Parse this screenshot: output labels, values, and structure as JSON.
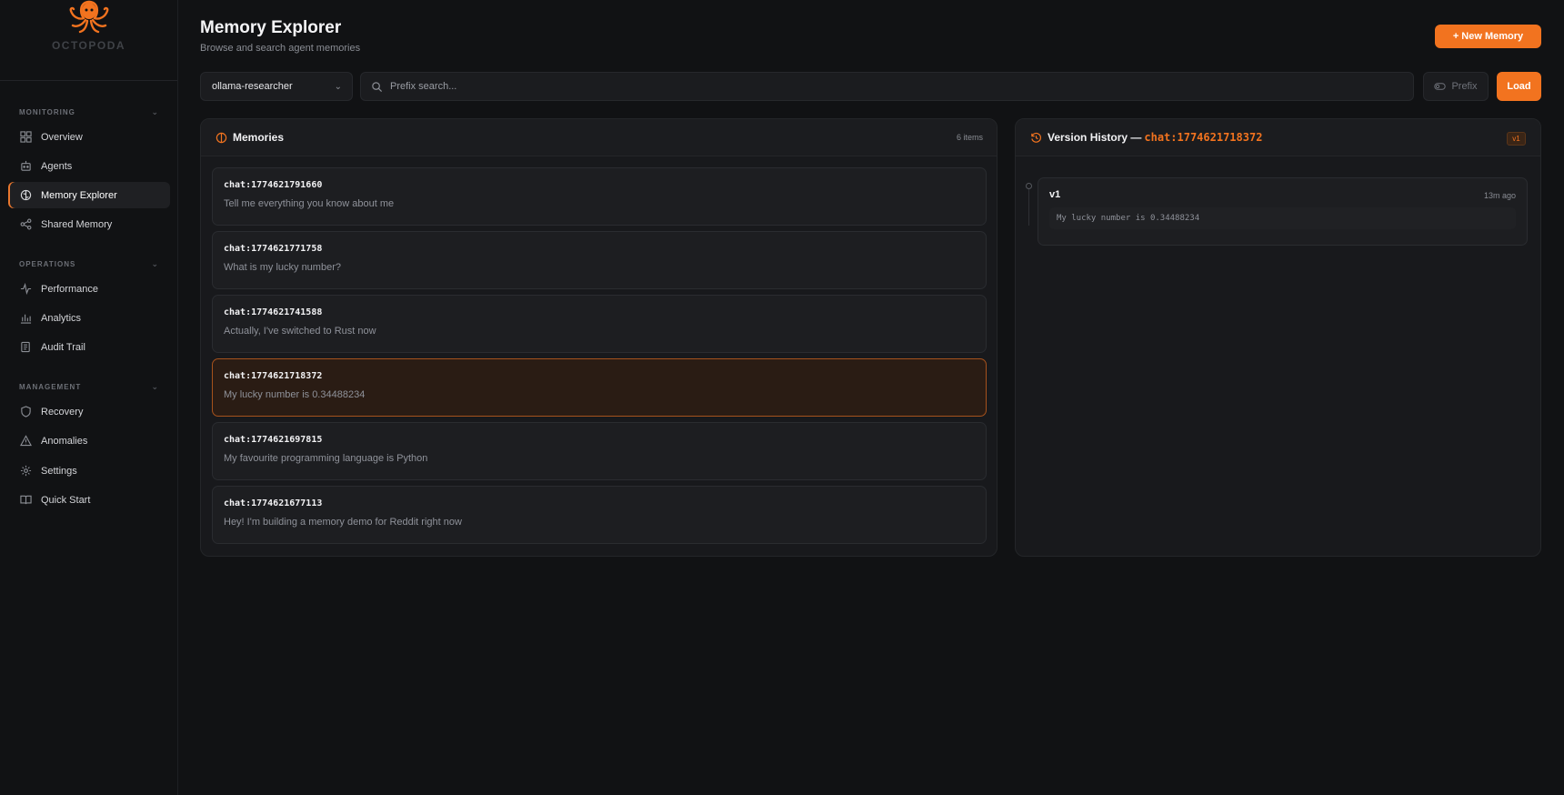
{
  "brand": {
    "name": "OCTOPODA",
    "accent": "#f2731f"
  },
  "sidebar": {
    "sections": [
      {
        "title": "MONITORING",
        "items": [
          {
            "label": "Overview",
            "icon": "grid-icon"
          },
          {
            "label": "Agents",
            "icon": "bot-icon"
          },
          {
            "label": "Memory Explorer",
            "icon": "brain-icon",
            "active": true
          },
          {
            "label": "Shared Memory",
            "icon": "share-icon"
          }
        ]
      },
      {
        "title": "OPERATIONS",
        "items": [
          {
            "label": "Performance",
            "icon": "activity-icon"
          },
          {
            "label": "Analytics",
            "icon": "bar-chart-icon"
          },
          {
            "label": "Audit Trail",
            "icon": "scroll-icon"
          }
        ]
      },
      {
        "title": "MANAGEMENT",
        "items": [
          {
            "label": "Recovery",
            "icon": "shield-icon"
          },
          {
            "label": "Anomalies",
            "icon": "warning-icon"
          },
          {
            "label": "Settings",
            "icon": "gear-icon"
          },
          {
            "label": "Quick Start",
            "icon": "book-icon"
          }
        ]
      }
    ]
  },
  "header": {
    "title": "Memory Explorer",
    "subtitle": "Browse and search agent memories",
    "new_memory_label": "+ New Memory"
  },
  "toolbar": {
    "agent_selected": "ollama-researcher",
    "search_placeholder": "Prefix search...",
    "prefix_label": "Prefix",
    "load_label": "Load"
  },
  "memories": {
    "title": "Memories",
    "count_label": "6 items",
    "items": [
      {
        "key": "chat:1774621791660",
        "value": "Tell me everything you know about me"
      },
      {
        "key": "chat:1774621771758",
        "value": "What is my lucky number?"
      },
      {
        "key": "chat:1774621741588",
        "value": "Actually, I've switched to Rust now"
      },
      {
        "key": "chat:1774621718372",
        "value": "My lucky number is 0.34488234",
        "selected": true
      },
      {
        "key": "chat:1774621697815",
        "value": "My favourite programming language is Python"
      },
      {
        "key": "chat:1774621677113",
        "value": "Hey! I'm building a memory demo for Reddit right now"
      }
    ]
  },
  "version_history": {
    "title": "Version History —",
    "key": "chat:1774621718372",
    "badge": "v1",
    "versions": [
      {
        "label": "v1",
        "time": "13m ago",
        "content": "My lucky number is 0.34488234"
      }
    ]
  }
}
